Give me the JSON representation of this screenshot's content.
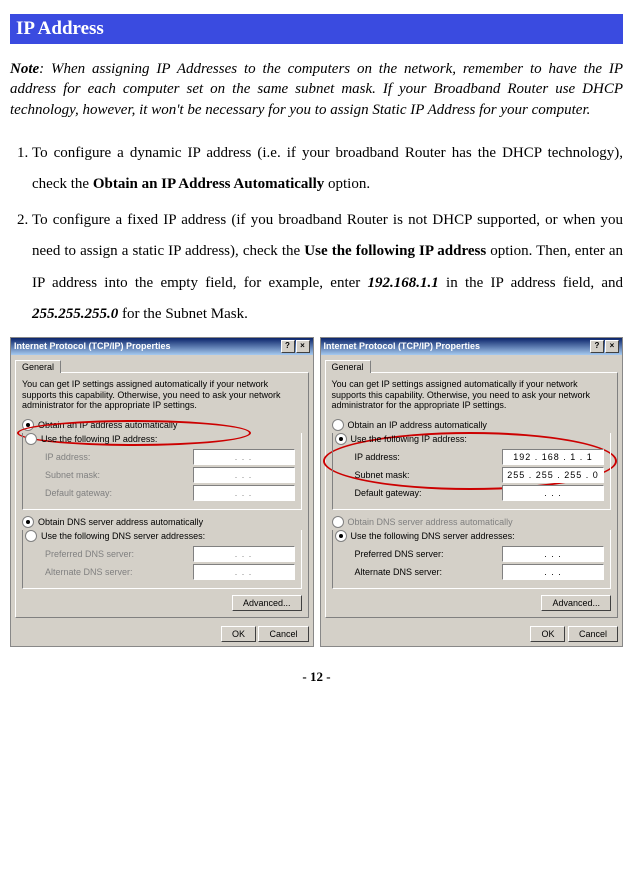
{
  "header": "IP Address",
  "note_prefix": "Note",
  "note_body": ": When assigning IP Addresses to the computers on the network, remember to have the IP address for each computer set on the same subnet mask. If your Broadband Router use DHCP technology, however, it won't be necessary for you to assign Static IP Address for your computer.",
  "list": {
    "item1_a": "To configure a dynamic IP address (i.e. if your broadband Router has the DHCP technology), check the ",
    "item1_b": "Obtain an IP Address Automatically",
    "item1_c": " option.",
    "item2_a": "To configure a fixed IP address (if you broadband Router is not DHCP supported, or when you need to assign a static IP address), check the ",
    "item2_b": "Use the following IP address",
    "item2_c": " option. Then, enter an IP address into the empty field, for example, enter ",
    "item2_d": "192.168.1.1",
    "item2_e": " in the IP address field, and ",
    "item2_f": "255.255.255.0",
    "item2_g": " for the Subnet Mask."
  },
  "dialog": {
    "title": "Internet Protocol (TCP/IP) Properties",
    "tab": "General",
    "intro": "You can get IP settings assigned automatically if your network supports this capability. Otherwise, you need to ask your network administrator for the appropriate IP settings.",
    "radio_auto_ip": "Obtain an IP address automatically",
    "radio_use_ip": "Use the following IP address:",
    "lbl_ip": "IP address:",
    "lbl_subnet": "Subnet mask:",
    "lbl_gateway": "Default gateway:",
    "radio_auto_dns": "Obtain DNS server address automatically",
    "radio_use_dns": "Use the following DNS server addresses:",
    "lbl_pref_dns": "Preferred DNS server:",
    "lbl_alt_dns": "Alternate DNS server:",
    "btn_adv": "Advanced...",
    "btn_ok": "OK",
    "btn_cancel": "Cancel",
    "ip_dots": ".       .       .",
    "ip_val": "192 . 168 .   1 .   1",
    "mask_val": "255 . 255 . 255 .   0"
  },
  "page_number": "- 12 -"
}
